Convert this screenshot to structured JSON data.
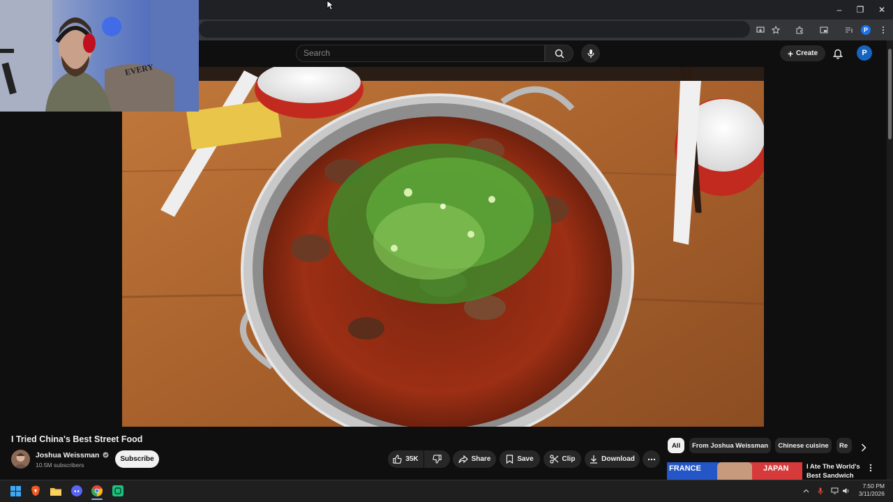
{
  "browser": {
    "window_controls": {
      "minimize": "–",
      "restore": "❐",
      "close": "✕"
    },
    "profile_initial": "P"
  },
  "youtube": {
    "search": {
      "placeholder": "Search"
    },
    "create_label": "Create",
    "avatar_initial": "P"
  },
  "video": {
    "title": "I Tried China's Best Street Food",
    "channel": {
      "name": "Joshua Weissman",
      "verified_icon": "verified-check-icon",
      "subscribers": "10.5M subscribers"
    },
    "subscribe_label": "Subscribe",
    "actions": {
      "like_count": "35K",
      "share_label": "Share",
      "save_label": "Save",
      "clip_label": "Clip",
      "download_label": "Download"
    }
  },
  "recommendations": {
    "chips": [
      "All",
      "From Joshua Weissman",
      "Chinese cuisine",
      "Re"
    ],
    "first": {
      "thumbnail_text_left": "FRANCE",
      "thumbnail_text_right": "JAPAN",
      "title": "I Ate The World's Best Sandwich"
    }
  },
  "webcam_overlay": {
    "shirt_text": "EVERY BUT F FIVE"
  },
  "taskbar": {
    "time": "7:50 PM",
    "date": "3/11/2026",
    "apps": [
      "windows-start",
      "brave",
      "file-explorer",
      "discord",
      "chrome",
      "chatgpt"
    ]
  },
  "colors": {
    "background": "#0f0f0f",
    "accent_blue": "#1565c0",
    "pill": "#272727"
  }
}
